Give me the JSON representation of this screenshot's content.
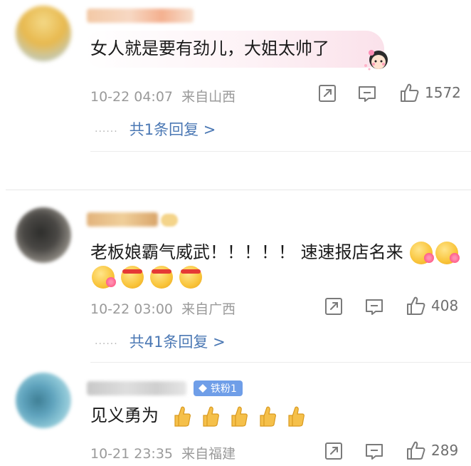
{
  "comments": [
    {
      "text": "女人就是要有劲儿，大姐太帅了",
      "time": "10-22 04:07",
      "location": "来自山西",
      "likes": "1572",
      "replies": "共1条回复 >",
      "avatar_colors": [
        "#f1d27a",
        "#e8b94f",
        "#9fb4a6"
      ],
      "username_colors": [
        "#f3c9a6",
        "#f7d8c3",
        "#f4b08f"
      ]
    },
    {
      "text": "老板娘霸气威武！！！！！ 速速报店名来",
      "time": "10-22 03:00",
      "location": "来自广西",
      "likes": "408",
      "replies": "共41条回复 >",
      "avatar_colors": [
        "#3a3a38",
        "#6f6c66",
        "#b8b4ac"
      ],
      "username_colors": [
        "#e2b37c",
        "#f0cf9a",
        "#d9a56a"
      ]
    },
    {
      "text": "见义勇为",
      "time": "10-21 23:35",
      "location": "来自福建",
      "likes": "289",
      "badge": "铁粉1",
      "avatar_colors": [
        "#5fa3bd",
        "#7fbfd2",
        "#c9e2ea"
      ],
      "username_colors": [
        "#c8c8c8",
        "#dedede",
        "#cfcfcf"
      ]
    }
  ],
  "icons": {
    "share": "share-icon",
    "comment": "comment-icon",
    "like": "thumbs-up-icon",
    "dots": "ellipsis-icon"
  },
  "colors": {
    "reply_link": "#4b78b4",
    "meta_text": "#9a9a9a",
    "badge": "#6f9ee8"
  }
}
